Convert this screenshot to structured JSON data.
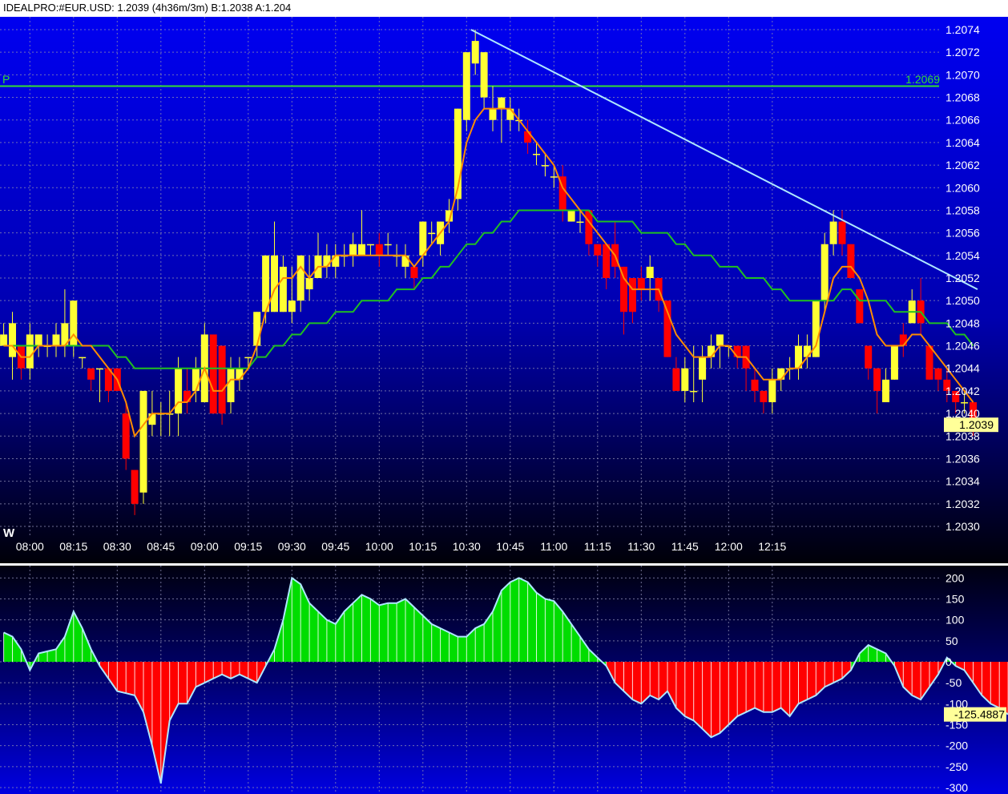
{
  "header": {
    "symbol": "IDEALPRO:#EUR.USD:",
    "last": "1.2039",
    "bar_info": "(4h36m/3m)",
    "bid": "B:1.2038",
    "ask": "A:1.204"
  },
  "price_panel": {
    "watermark": "W",
    "pivot_label": "P",
    "pivot_value_label": "1.2069",
    "last_price_label": "1.2039"
  },
  "osc_panel": {
    "current_value_label": "-125.4887"
  },
  "colors": {
    "background_top": "#0000f0",
    "background_bottom": "#000000",
    "grid": "#8a8ab0",
    "up_candle": "#ffff33",
    "down_candle": "#ff0000",
    "fast_ma": "#ff8c00",
    "slow_ma": "#20c020",
    "pivot_line": "#33dd33",
    "trend_line": "#aee8ff",
    "osc_positive": "#00dd00",
    "osc_negative": "#ff0000",
    "osc_outline": "#aee8ff",
    "label_bg": "#ffff99"
  },
  "chart_data": [
    {
      "type": "candlestick",
      "panel": "price",
      "x_ticks": [
        "08:00",
        "08:15",
        "08:30",
        "08:45",
        "09:00",
        "09:15",
        "09:30",
        "09:45",
        "10:00",
        "10:15",
        "10:30",
        "10:45",
        "11:00",
        "11:15",
        "11:30",
        "11:45",
        "12:00",
        "12:15"
      ],
      "ylim": [
        1.2029,
        1.2075
      ],
      "y_ticks": [
        "1.2030",
        "1.2032",
        "1.2034",
        "1.2036",
        "1.2038",
        "1.2040",
        "1.2042",
        "1.2044",
        "1.2046",
        "1.2048",
        "1.2050",
        "1.2052",
        "1.2054",
        "1.2056",
        "1.2058",
        "1.2060",
        "1.2062",
        "1.2064",
        "1.2066",
        "1.2068",
        "1.2070",
        "1.2072",
        "1.2074"
      ],
      "grid": true,
      "bar_interval_minutes": 3,
      "start_time": "07:51",
      "ohlc": [
        [
          1.2046,
          1.2048,
          1.2046,
          1.2047
        ],
        [
          1.2045,
          1.2049,
          1.2043,
          1.2048
        ],
        [
          1.2046,
          1.2046,
          1.2043,
          1.2044
        ],
        [
          1.2044,
          1.2048,
          1.2043,
          1.2047
        ],
        [
          1.2046,
          1.2047,
          1.2045,
          1.2047
        ],
        [
          1.2046,
          1.2047,
          1.2045,
          1.2046
        ],
        [
          1.2046,
          1.2048,
          1.2045,
          1.2047
        ],
        [
          1.2046,
          1.2051,
          1.2045,
          1.2048
        ],
        [
          1.2046,
          1.2049,
          1.2045,
          1.205
        ],
        [
          1.2045,
          1.2045,
          1.2044,
          1.2045
        ],
        [
          1.2044,
          1.2044,
          1.2042,
          1.2043
        ],
        [
          1.2044,
          1.2044,
          1.2041,
          1.2044
        ],
        [
          1.2044,
          1.2044,
          1.2041,
          1.2042
        ],
        [
          1.2044,
          1.2044,
          1.2042,
          1.2042
        ],
        [
          1.204,
          1.2041,
          1.2035,
          1.2036
        ],
        [
          1.2035,
          1.2035,
          1.2031,
          1.2032
        ],
        [
          1.2033,
          1.2042,
          1.2032,
          1.2042
        ],
        [
          1.2039,
          1.2042,
          1.2038,
          1.204
        ],
        [
          1.204,
          1.2041,
          1.2038,
          1.204
        ],
        [
          1.204,
          1.2042,
          1.2038,
          1.204
        ],
        [
          1.204,
          1.2045,
          1.2038,
          1.2044
        ],
        [
          1.2042,
          1.2044,
          1.204,
          1.2041
        ],
        [
          1.2042,
          1.2045,
          1.2041,
          1.2044
        ],
        [
          1.2041,
          1.2048,
          1.2041,
          1.2047
        ],
        [
          1.2047,
          1.2047,
          1.204,
          1.204
        ],
        [
          1.2046,
          1.2046,
          1.2039,
          1.204
        ],
        [
          1.2041,
          1.2045,
          1.204,
          1.2044
        ],
        [
          1.2043,
          1.2045,
          1.2042,
          1.2044
        ],
        [
          1.2045,
          1.2045,
          1.2044,
          1.2045
        ],
        [
          1.2046,
          1.2049,
          1.2045,
          1.2049
        ],
        [
          1.2049,
          1.2054,
          1.2048,
          1.2054
        ],
        [
          1.2049,
          1.2057,
          1.2049,
          1.2054
        ],
        [
          1.2049,
          1.2054,
          1.2049,
          1.2053
        ],
        [
          1.2049,
          1.2053,
          1.2048,
          1.205
        ],
        [
          1.205,
          1.2054,
          1.2049,
          1.2054
        ],
        [
          1.2051,
          1.2054,
          1.205,
          1.2052
        ],
        [
          1.2052,
          1.2056,
          1.2052,
          1.2054
        ],
        [
          1.2053,
          1.2055,
          1.2052,
          1.2054
        ],
        [
          1.2053,
          1.2055,
          1.2052,
          1.2054
        ],
        [
          1.2054,
          1.2055,
          1.2053,
          1.2054
        ],
        [
          1.2054,
          1.2056,
          1.2053,
          1.2055
        ],
        [
          1.2054,
          1.2058,
          1.2054,
          1.2055
        ],
        [
          1.2055,
          1.2055,
          1.2054,
          1.2055
        ],
        [
          1.2055,
          1.2056,
          1.2053,
          1.2054
        ],
        [
          1.2055,
          1.2056,
          1.2054,
          1.2055
        ],
        [
          1.2054,
          1.2055,
          1.2053,
          1.2054
        ],
        [
          1.2053,
          1.2055,
          1.2052,
          1.2054
        ],
        [
          1.2053,
          1.2053,
          1.2051,
          1.2052
        ],
        [
          1.2054,
          1.2057,
          1.2053,
          1.2057
        ],
        [
          1.2056,
          1.2057,
          1.2055,
          1.2056
        ],
        [
          1.2055,
          1.2057,
          1.2054,
          1.2057
        ],
        [
          1.2057,
          1.2059,
          1.2056,
          1.2058
        ],
        [
          1.2059,
          1.2067,
          1.2058,
          1.2067
        ],
        [
          1.2066,
          1.2072,
          1.2065,
          1.2072
        ],
        [
          1.2071,
          1.2074,
          1.207,
          1.2073
        ],
        [
          1.2068,
          1.2072,
          1.2067,
          1.2072
        ],
        [
          1.2066,
          1.2069,
          1.2065,
          1.2067
        ],
        [
          1.2067,
          1.2068,
          1.2064,
          1.2068
        ],
        [
          1.2066,
          1.2068,
          1.2065,
          1.2067
        ],
        [
          1.2066,
          1.2067,
          1.2065,
          1.2066
        ],
        [
          1.2065,
          1.2066,
          1.2063,
          1.2064
        ],
        [
          1.2063,
          1.2064,
          1.2062,
          1.2063
        ],
        [
          1.2062,
          1.2063,
          1.2061,
          1.2062
        ],
        [
          1.2061,
          1.2062,
          1.206,
          1.2061
        ],
        [
          1.2061,
          1.2062,
          1.2057,
          1.2058
        ],
        [
          1.2057,
          1.2058,
          1.2057,
          1.2058
        ],
        [
          1.2057,
          1.2058,
          1.2056,
          1.2057
        ],
        [
          1.2058,
          1.2058,
          1.2054,
          1.2055
        ],
        [
          1.2055,
          1.2055,
          1.2053,
          1.2054
        ],
        [
          1.2055,
          1.2055,
          1.2051,
          1.2052
        ],
        [
          1.2055,
          1.2057,
          1.2052,
          1.2053
        ],
        [
          1.2053,
          1.2053,
          1.2047,
          1.2049
        ],
        [
          1.2052,
          1.2052,
          1.2048,
          1.2049
        ],
        [
          1.2052,
          1.2053,
          1.205,
          1.2051
        ],
        [
          1.2052,
          1.2054,
          1.205,
          1.2053
        ],
        [
          1.2052,
          1.2052,
          1.2049,
          1.205
        ],
        [
          1.205,
          1.205,
          1.2045,
          1.2045
        ],
        [
          1.2044,
          1.2045,
          1.2042,
          1.2042
        ],
        [
          1.2042,
          1.2045,
          1.2041,
          1.2044
        ],
        [
          1.2042,
          1.2046,
          1.2041,
          1.2042
        ],
        [
          1.2043,
          1.2046,
          1.2041,
          1.2045
        ],
        [
          1.2045,
          1.2047,
          1.2044,
          1.2046
        ],
        [
          1.2046,
          1.2047,
          1.2044,
          1.2047
        ],
        [
          1.2046,
          1.2046,
          1.2045,
          1.2046
        ],
        [
          1.2046,
          1.2046,
          1.2044,
          1.2045
        ],
        [
          1.2046,
          1.2046,
          1.2042,
          1.2044
        ],
        [
          1.2043,
          1.2044,
          1.2041,
          1.2042
        ],
        [
          1.2042,
          1.2042,
          1.204,
          1.2041
        ],
        [
          1.2041,
          1.2044,
          1.204,
          1.2043
        ],
        [
          1.2043,
          1.2044,
          1.2042,
          1.2044
        ],
        [
          1.2044,
          1.2045,
          1.2043,
          1.2044
        ],
        [
          1.2044,
          1.2047,
          1.2043,
          1.2046
        ],
        [
          1.2045,
          1.2047,
          1.2044,
          1.2046
        ],
        [
          1.2045,
          1.205,
          1.2045,
          1.205
        ],
        [
          1.205,
          1.2056,
          1.2049,
          1.2055
        ],
        [
          1.2055,
          1.2058,
          1.2054,
          1.2057
        ],
        [
          1.2057,
          1.2058,
          1.2054,
          1.2055
        ],
        [
          1.2055,
          1.2055,
          1.2052,
          1.2052
        ],
        [
          1.2051,
          1.2051,
          1.2048,
          1.2048
        ],
        [
          1.2046,
          1.2046,
          1.2043,
          1.2044
        ],
        [
          1.2044,
          1.2044,
          1.204,
          1.2042
        ],
        [
          1.2041,
          1.2044,
          1.2041,
          1.2043
        ],
        [
          1.2043,
          1.2046,
          1.2043,
          1.2046
        ],
        [
          1.2047,
          1.2048,
          1.2045,
          1.2046
        ],
        [
          1.2048,
          1.2051,
          1.2048,
          1.205
        ],
        [
          1.205,
          1.2052,
          1.2047,
          1.2048
        ],
        [
          1.2046,
          1.2046,
          1.2043,
          1.2043
        ],
        [
          1.2044,
          1.2044,
          1.2042,
          1.2043
        ],
        [
          1.2043,
          1.2044,
          1.2041,
          1.2042
        ],
        [
          1.2042,
          1.2042,
          1.204,
          1.2041
        ],
        [
          1.2041,
          1.2042,
          1.204,
          1.2041
        ],
        [
          1.2041,
          1.2041,
          1.2038,
          1.2039
        ]
      ],
      "fast_ma": [
        1.2046,
        1.2046,
        1.2045,
        1.2045,
        1.2046,
        1.2046,
        1.2046,
        1.2046,
        1.2047,
        1.2046,
        1.2046,
        1.2045,
        1.2044,
        1.2043,
        1.2041,
        1.2038,
        1.2039,
        1.204,
        1.204,
        1.204,
        1.2041,
        1.2041,
        1.2042,
        1.2044,
        1.2042,
        1.2042,
        1.2043,
        1.2043,
        1.2044,
        1.2046,
        1.2049,
        1.2051,
        1.2052,
        1.2052,
        1.2053,
        1.2052,
        1.2053,
        1.2053,
        1.2054,
        1.2054,
        1.2054,
        1.2054,
        1.2054,
        1.2054,
        1.2054,
        1.2054,
        1.2054,
        1.2053,
        1.2054,
        1.2055,
        1.2056,
        1.2057,
        1.206,
        1.2064,
        1.2066,
        1.2067,
        1.2067,
        1.2067,
        1.2067,
        1.2066,
        1.2065,
        1.2064,
        1.2063,
        1.2062,
        1.206,
        1.2059,
        1.2058,
        1.2057,
        1.2056,
        1.2055,
        1.2054,
        1.2052,
        1.2051,
        1.2051,
        1.2051,
        1.2051,
        1.2049,
        1.2047,
        1.2046,
        1.2045,
        1.2045,
        1.2045,
        1.2046,
        1.2046,
        1.2045,
        1.2045,
        1.2044,
        1.2043,
        1.2043,
        1.2043,
        1.2044,
        1.2044,
        1.2045,
        1.2046,
        1.2049,
        1.2052,
        1.2053,
        1.2053,
        1.2052,
        1.205,
        1.2047,
        1.2046,
        1.2046,
        1.2046,
        1.2047,
        1.2047,
        1.2046,
        1.2045,
        1.2044,
        1.2043,
        1.2042,
        1.2041
      ],
      "slow_ma": [
        1.2046,
        1.2046,
        1.2046,
        1.2046,
        1.2046,
        1.2046,
        1.2046,
        1.2046,
        1.2046,
        1.2046,
        1.2046,
        1.2046,
        1.2046,
        1.2045,
        1.2045,
        1.2044,
        1.2044,
        1.2044,
        1.2044,
        1.2044,
        1.2044,
        1.2044,
        1.2044,
        1.2044,
        1.2044,
        1.2044,
        1.2044,
        1.2044,
        1.2044,
        1.2045,
        1.2045,
        1.2046,
        1.2046,
        1.2047,
        1.2047,
        1.2048,
        1.2048,
        1.2048,
        1.2049,
        1.2049,
        1.2049,
        1.205,
        1.205,
        1.205,
        1.205,
        1.2051,
        1.2051,
        1.2051,
        1.2052,
        1.2052,
        1.2053,
        1.2053,
        1.2054,
        1.2055,
        1.2055,
        1.2056,
        1.2056,
        1.2057,
        1.2057,
        1.2058,
        1.2058,
        1.2058,
        1.2058,
        1.2058,
        1.2058,
        1.2058,
        1.2058,
        1.2058,
        1.2057,
        1.2057,
        1.2057,
        1.2057,
        1.2057,
        1.2056,
        1.2056,
        1.2056,
        1.2056,
        1.2055,
        1.2055,
        1.2054,
        1.2054,
        1.2054,
        1.2053,
        1.2053,
        1.2053,
        1.2052,
        1.2052,
        1.2052,
        1.2051,
        1.2051,
        1.205,
        1.205,
        1.205,
        1.205,
        1.205,
        1.205,
        1.2051,
        1.2051,
        1.205,
        1.205,
        1.205,
        1.205,
        1.2049,
        1.2049,
        1.2049,
        1.2049,
        1.2048,
        1.2048,
        1.2048,
        1.2047,
        1.2047,
        1.2046
      ],
      "pivot": 1.2069,
      "trend_line": {
        "from": {
          "bar": 53.5,
          "price": 1.2074
        },
        "to": {
          "bar": 111.5,
          "price": 1.2051
        }
      },
      "last_price": 1.2039
    },
    {
      "type": "area",
      "panel": "oscillator",
      "ylim": [
        -300,
        220
      ],
      "y_ticks": [
        "200",
        "150",
        "100",
        "50",
        "0",
        "-50",
        "-100",
        "-150",
        "-200",
        "-250",
        "-300"
      ],
      "grid": true,
      "values": [
        70,
        60,
        30,
        -20,
        20,
        25,
        30,
        60,
        120,
        80,
        30,
        -10,
        -40,
        -70,
        -75,
        -80,
        -120,
        -200,
        -290,
        -140,
        -100,
        -100,
        -60,
        -50,
        -40,
        -30,
        -40,
        -30,
        -40,
        -50,
        -10,
        30,
        100,
        200,
        185,
        140,
        120,
        100,
        90,
        120,
        140,
        160,
        150,
        135,
        140,
        140,
        150,
        130,
        110,
        90,
        80,
        70,
        60,
        60,
        80,
        90,
        120,
        170,
        190,
        200,
        190,
        165,
        150,
        145,
        120,
        90,
        60,
        30,
        10,
        -10,
        -50,
        -70,
        -90,
        -100,
        -80,
        -90,
        -70,
        -110,
        -130,
        -140,
        -160,
        -180,
        -170,
        -150,
        -130,
        -120,
        -110,
        -120,
        -120,
        -110,
        -130,
        -100,
        -90,
        -80,
        -60,
        -50,
        -40,
        -20,
        20,
        40,
        30,
        20,
        -10,
        -60,
        -80,
        -90,
        -60,
        -30,
        10,
        -10,
        -20,
        -50,
        -80,
        -100,
        -110,
        -125.4887
      ]
    }
  ]
}
